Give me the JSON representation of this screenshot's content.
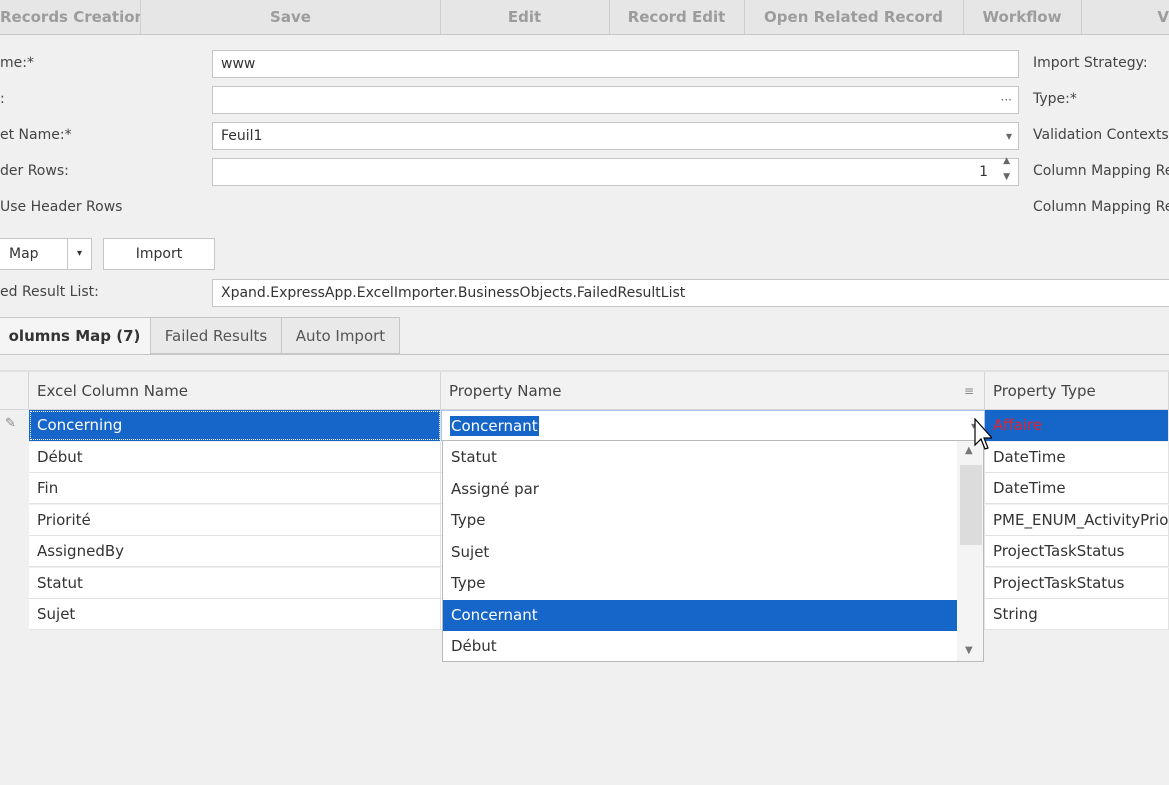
{
  "toolbar": {
    "items": [
      {
        "label": "Records Creation"
      },
      {
        "label": "Save"
      },
      {
        "label": "Edit"
      },
      {
        "label": "Record Edit"
      },
      {
        "label": "Open Related Record"
      },
      {
        "label": "Workflow"
      },
      {
        "label": "V"
      }
    ]
  },
  "form": {
    "name_label": "me:*",
    "name_value": "www",
    "file_label": ":",
    "file_value": "",
    "file_suffix": "···",
    "sheet_label": "et Name:*",
    "sheet_value": "Feuil1",
    "sheet_dropdown": "▾",
    "header_rows_label": "der Rows:",
    "header_rows_value": "1",
    "use_header_rows_label": "Use Header Rows",
    "right_labels": [
      "Import Strategy:",
      "Type:*",
      "Validation Contexts",
      "Column Mapping Re",
      "Column Mapping Re"
    ],
    "map_button": "Map",
    "import_button": "Import",
    "failed_result_label": "ed Result List:",
    "failed_result_value": "Xpand.ExpressApp.ExcelImporter.BusinessObjects.FailedResultList"
  },
  "tabs": [
    {
      "label": "olumns Map (7)"
    },
    {
      "label": "Failed Results"
    },
    {
      "label": "Auto Import"
    }
  ],
  "grid": {
    "headers": [
      "Excel Column Name",
      "Property Name",
      "Property Type"
    ],
    "rows": [
      {
        "excel": "Concerning",
        "property": "Concernant",
        "type": "Affaire"
      },
      {
        "excel": "Début",
        "property": "",
        "type": "DateTime"
      },
      {
        "excel": "Fin",
        "property": "",
        "type": "DateTime"
      },
      {
        "excel": "Priorité",
        "property": "",
        "type": "PME_ENUM_ActivityPrior"
      },
      {
        "excel": "AssignedBy",
        "property": "",
        "type": "ProjectTaskStatus"
      },
      {
        "excel": "Statut",
        "property": "",
        "type": "ProjectTaskStatus"
      },
      {
        "excel": "Sujet",
        "property": "",
        "type": "String"
      }
    ]
  },
  "dropdown": {
    "items": [
      "Statut",
      "Assigné par",
      "Type",
      "Sujet",
      "Type",
      "Concernant",
      "Début"
    ],
    "selected_index": 5
  },
  "colors": {
    "selection": "#1665c9",
    "error_text": "#e0242a"
  }
}
